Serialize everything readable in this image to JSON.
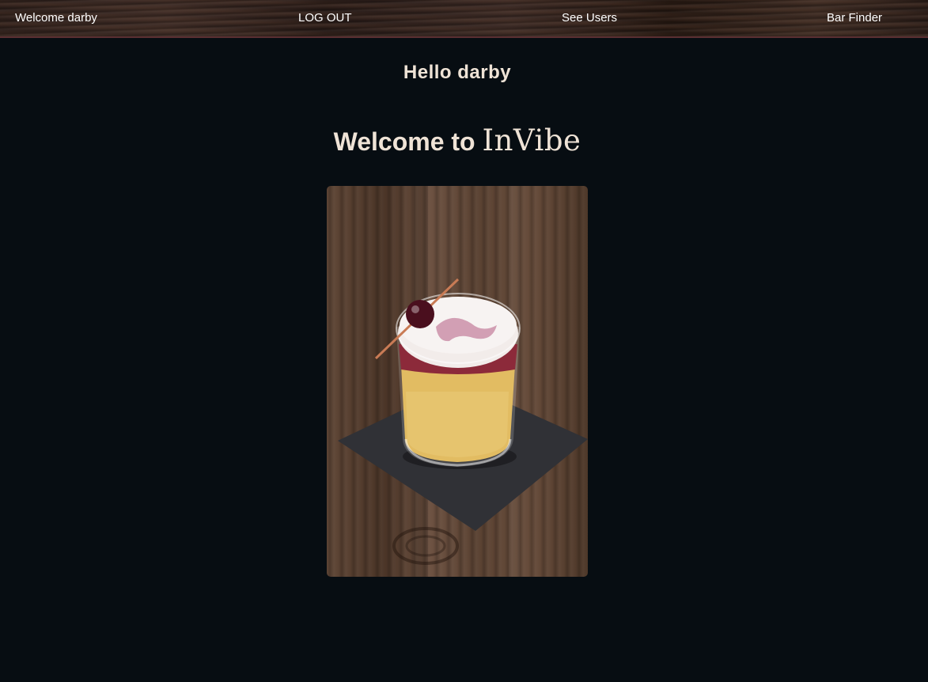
{
  "nav": {
    "welcome": "Welcome darby",
    "logout": "LOG OUT",
    "see_users": "See Users",
    "bar_finder": "Bar Finder"
  },
  "main": {
    "hello": "Hello darby",
    "welcome_prefix": "Welcome to ",
    "brand": "InVibe"
  },
  "colors": {
    "background": "#070d12",
    "heading_text": "#efe3d6",
    "nav_text": "#ffffff",
    "nav_border": "#5a2f32"
  },
  "image": {
    "icon": "cocktail-photo"
  }
}
